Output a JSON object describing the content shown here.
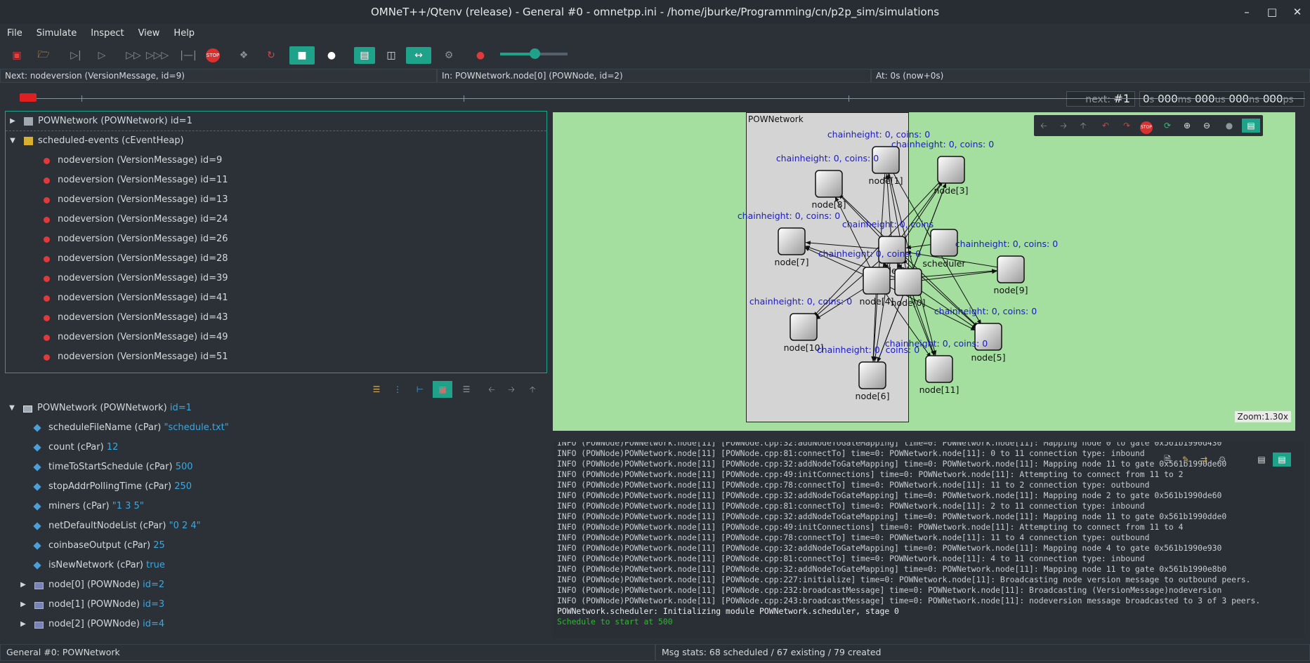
{
  "window": {
    "title": "OMNeT++/Qtenv (release) - General #0 - omnetpp.ini - /home/jburke/Programming/cn/p2p_sim/simulations"
  },
  "menu": [
    "File",
    "Simulate",
    "Inspect",
    "View",
    "Help"
  ],
  "toolbar": {
    "next_label": "next:",
    "next_value": "#1",
    "time_s": "0",
    "time_ms": "000",
    "time_us": "000",
    "time_ns": "000",
    "time_ps": "000",
    "unit_s": "s",
    "unit_ms": "ms",
    "unit_us": "us",
    "unit_ns": "ns",
    "unit_ps": "ps"
  },
  "infobar": {
    "next": "Next: nodeversion (VersionMessage, id=9)",
    "in": "In: POWNetwork.node[0] (POWNode, id=2)",
    "at": "At: 0s (now+0s)"
  },
  "object_tree": [
    {
      "text": "POWNetwork (POWNetwork) id=1",
      "level": 0,
      "expanded": false,
      "icon": "network-icon"
    },
    {
      "text": "scheduled-events (cEventHeap)",
      "level": 0,
      "expanded": true,
      "icon": "heap-icon"
    },
    {
      "text": "nodeversion (VersionMessage) id=9",
      "level": 1,
      "icon": "message-icon"
    },
    {
      "text": "nodeversion (VersionMessage) id=11",
      "level": 1,
      "icon": "message-icon"
    },
    {
      "text": "nodeversion (VersionMessage) id=13",
      "level": 1,
      "icon": "message-icon"
    },
    {
      "text": "nodeversion (VersionMessage) id=24",
      "level": 1,
      "icon": "message-icon"
    },
    {
      "text": "nodeversion (VersionMessage) id=26",
      "level": 1,
      "icon": "message-icon"
    },
    {
      "text": "nodeversion (VersionMessage) id=28",
      "level": 1,
      "icon": "message-icon"
    },
    {
      "text": "nodeversion (VersionMessage) id=39",
      "level": 1,
      "icon": "message-icon"
    },
    {
      "text": "nodeversion (VersionMessage) id=41",
      "level": 1,
      "icon": "message-icon"
    },
    {
      "text": "nodeversion (VersionMessage) id=43",
      "level": 1,
      "icon": "message-icon"
    },
    {
      "text": "nodeversion (VersionMessage) id=49",
      "level": 1,
      "icon": "message-icon"
    },
    {
      "text": "nodeversion (VersionMessage) id=51",
      "level": 1,
      "icon": "message-icon"
    }
  ],
  "inspector": [
    {
      "name": "POWNetwork (POWNetwork)",
      "value": "id=1",
      "level": 0,
      "kind": "network",
      "expanded": true
    },
    {
      "name": "scheduleFileName (cPar)",
      "value": "\"schedule.txt\"",
      "level": 1,
      "kind": "param"
    },
    {
      "name": "count (cPar)",
      "value": "12",
      "level": 1,
      "kind": "param"
    },
    {
      "name": "timeToStartSchedule (cPar)",
      "value": "500",
      "level": 1,
      "kind": "param"
    },
    {
      "name": "stopAddrPollingTime (cPar)",
      "value": "250",
      "level": 1,
      "kind": "param"
    },
    {
      "name": "miners (cPar)",
      "value": "\"1 3 5\"",
      "level": 1,
      "kind": "param"
    },
    {
      "name": "netDefaultNodeList (cPar)",
      "value": "\"0 2 4\"",
      "level": 1,
      "kind": "param"
    },
    {
      "name": "coinbaseOutput (cPar)",
      "value": "25",
      "level": 1,
      "kind": "param"
    },
    {
      "name": "isNewNetwork (cPar)",
      "value": "true",
      "level": 1,
      "kind": "param"
    },
    {
      "name": "node[0] (POWNode)",
      "value": "id=2",
      "level": 1,
      "kind": "module"
    },
    {
      "name": "node[1] (POWNode)",
      "value": "id=3",
      "level": 1,
      "kind": "module"
    },
    {
      "name": "node[2] (POWNode)",
      "value": "id=4",
      "level": 1,
      "kind": "module"
    }
  ],
  "network": {
    "title": "POWNetwork",
    "zoom": "Zoom:1.30x",
    "nodes": [
      {
        "name": "node[1]",
        "status": "chainheight: 0, coins: 0"
      },
      {
        "name": "node[3]",
        "status": "chainheight: 0, coins: 0"
      },
      {
        "name": "node[8]",
        "status": "chainheight: 0, coins: 0"
      },
      {
        "name": "node[7]",
        "status": "chainheight: 0, coins: 0"
      },
      {
        "name": "node[2]",
        "status": "chainheight: 0, coins"
      },
      {
        "name": "scheduler",
        "status": ""
      },
      {
        "name": "node[9]",
        "status": "chainheight: 0, coins: 0"
      },
      {
        "name": "node[4]",
        "status": "chainheight: 0, coins: 0"
      },
      {
        "name": "node[0]",
        "status": ""
      },
      {
        "name": "node[10]",
        "status": "chainheight: 0, coins: 0"
      },
      {
        "name": "node[5]",
        "status": "chainheight: 0, coins: 0"
      },
      {
        "name": "node[11]",
        "status": "chainheight: 0, coins: 0"
      },
      {
        "name": "node[6]",
        "status": "chainheight: 0, coins: 0"
      }
    ]
  },
  "log": [
    "INFO (POWNode)POWNetwork.node[11] [POWNode.cpp:32:addNodeToGateMapping] time=0: POWNetwork.node[11]: Mapping node 0 to gate 0x561b1990d430",
    "INFO (POWNode)POWNetwork.node[11] [POWNode.cpp:81:connectTo] time=0: POWNetwork.node[11]: 0 to 11 connection type: inbound",
    "INFO (POWNode)POWNetwork.node[11] [POWNode.cpp:32:addNodeToGateMapping] time=0: POWNetwork.node[11]: Mapping node 11 to gate 0x561b1990de60",
    "INFO (POWNode)POWNetwork.node[11] [POWNode.cpp:49:initConnections] time=0: POWNetwork.node[11]: Attempting to connect from 11 to 2",
    "INFO (POWNode)POWNetwork.node[11] [POWNode.cpp:78:connectTo] time=0: POWNetwork.node[11]: 11 to 2 connection type: outbound",
    "INFO (POWNode)POWNetwork.node[11] [POWNode.cpp:32:addNodeToGateMapping] time=0: POWNetwork.node[11]: Mapping node 2 to gate 0x561b1990de60",
    "INFO (POWNode)POWNetwork.node[11] [POWNode.cpp:81:connectTo] time=0: POWNetwork.node[11]: 2 to 11 connection type: inbound",
    "INFO (POWNode)POWNetwork.node[11] [POWNode.cpp:32:addNodeToGateMapping] time=0: POWNetwork.node[11]: Mapping node 11 to gate 0x561b1990dde0",
    "INFO (POWNode)POWNetwork.node[11] [POWNode.cpp:49:initConnections] time=0: POWNetwork.node[11]: Attempting to connect from 11 to 4",
    "INFO (POWNode)POWNetwork.node[11] [POWNode.cpp:78:connectTo] time=0: POWNetwork.node[11]: 11 to 4 connection type: outbound",
    "INFO (POWNode)POWNetwork.node[11] [POWNode.cpp:32:addNodeToGateMapping] time=0: POWNetwork.node[11]: Mapping node 4 to gate 0x561b1990e930",
    "INFO (POWNode)POWNetwork.node[11] [POWNode.cpp:81:connectTo] time=0: POWNetwork.node[11]: 4 to 11 connection type: inbound",
    "INFO (POWNode)POWNetwork.node[11] [POWNode.cpp:32:addNodeToGateMapping] time=0: POWNetwork.node[11]: Mapping node 11 to gate 0x561b1990e8b0",
    "INFO (POWNode)POWNetwork.node[11] [POWNode.cpp:227:initialize] time=0: POWNetwork.node[11]: Broadcasting node version message to outbound peers.",
    "INFO (POWNode)POWNetwork.node[11] [POWNode.cpp:232:broadcastMessage] time=0: POWNetwork.node[11]: Broadcasting (VersionMessage)nodeversion",
    "INFO (POWNode)POWNetwork.node[11] [POWNode.cpp:243:broadcastMessage] time=0: POWNetwork.node[11]: nodeversion message broadcasted to 3 of 3 peers."
  ],
  "log_header": "POWNetwork.scheduler: Initializing module POWNetwork.scheduler, stage 0",
  "log_last": "Schedule to start at 500",
  "status": {
    "left": "General #0: POWNetwork",
    "right": "Msg stats: 68 scheduled / 67 existing / 79 created"
  },
  "colors": {
    "accent": "#1ea28a",
    "canvas": "#a4dfa0",
    "message_dot": "#e03a3a",
    "value": "#3ba8e0",
    "node_status": "#1a1ad0"
  }
}
